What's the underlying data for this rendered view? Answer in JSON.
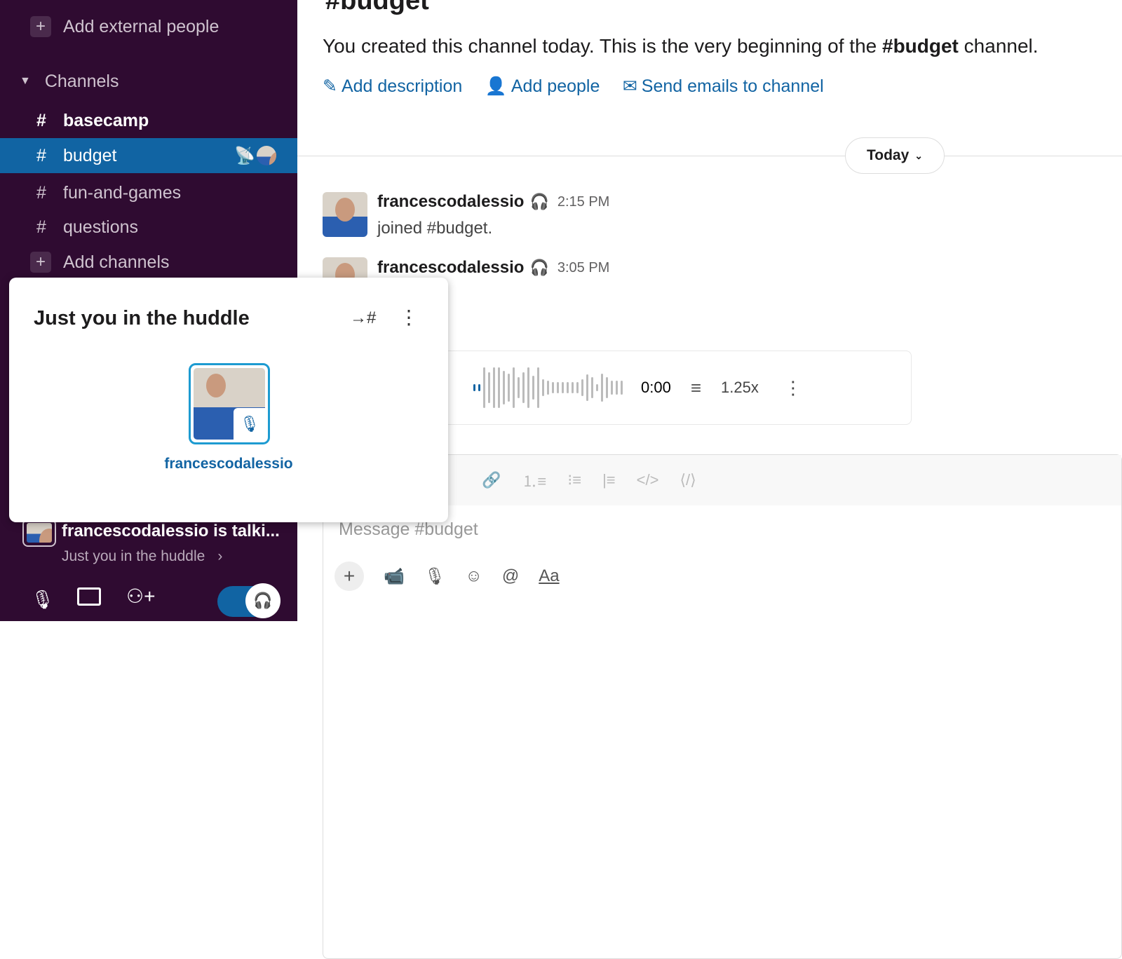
{
  "sidebar": {
    "add_external": "Add external people",
    "channels_header": "Channels",
    "channels": [
      {
        "name": "basecamp"
      },
      {
        "name": "budget"
      },
      {
        "name": "fun-and-games"
      },
      {
        "name": "questions"
      }
    ],
    "add_channels": "Add channels",
    "huddle_status": "francescodalessio is talki...",
    "huddle_sub": "Just you in the huddle"
  },
  "main": {
    "channel_title": "#budget",
    "intro_prefix": "You created this channel today. This is the very beginning of the ",
    "intro_channel": "#budget",
    "intro_suffix": " channel.",
    "actions": [
      "Add description",
      "Add people",
      "Send emails to channel"
    ],
    "date_divider": "Today",
    "messages": [
      {
        "user": "francescodalessio",
        "time": "2:15 PM",
        "text": "joined #budget."
      },
      {
        "user": "francescodalessio",
        "time": "3:05 PM"
      }
    ],
    "audio": {
      "time": "0:00",
      "speed": "1.25x"
    },
    "composer_placeholder": "Message #budget",
    "composer_aa": "Aa"
  },
  "huddle_popup": {
    "title": "Just you in the huddle",
    "participant": "francescodalessio",
    "move_to_channel": "→#"
  },
  "colors": {
    "sidebar": "#2f0b31",
    "selected": "#1164a3",
    "link": "#1264a3"
  }
}
